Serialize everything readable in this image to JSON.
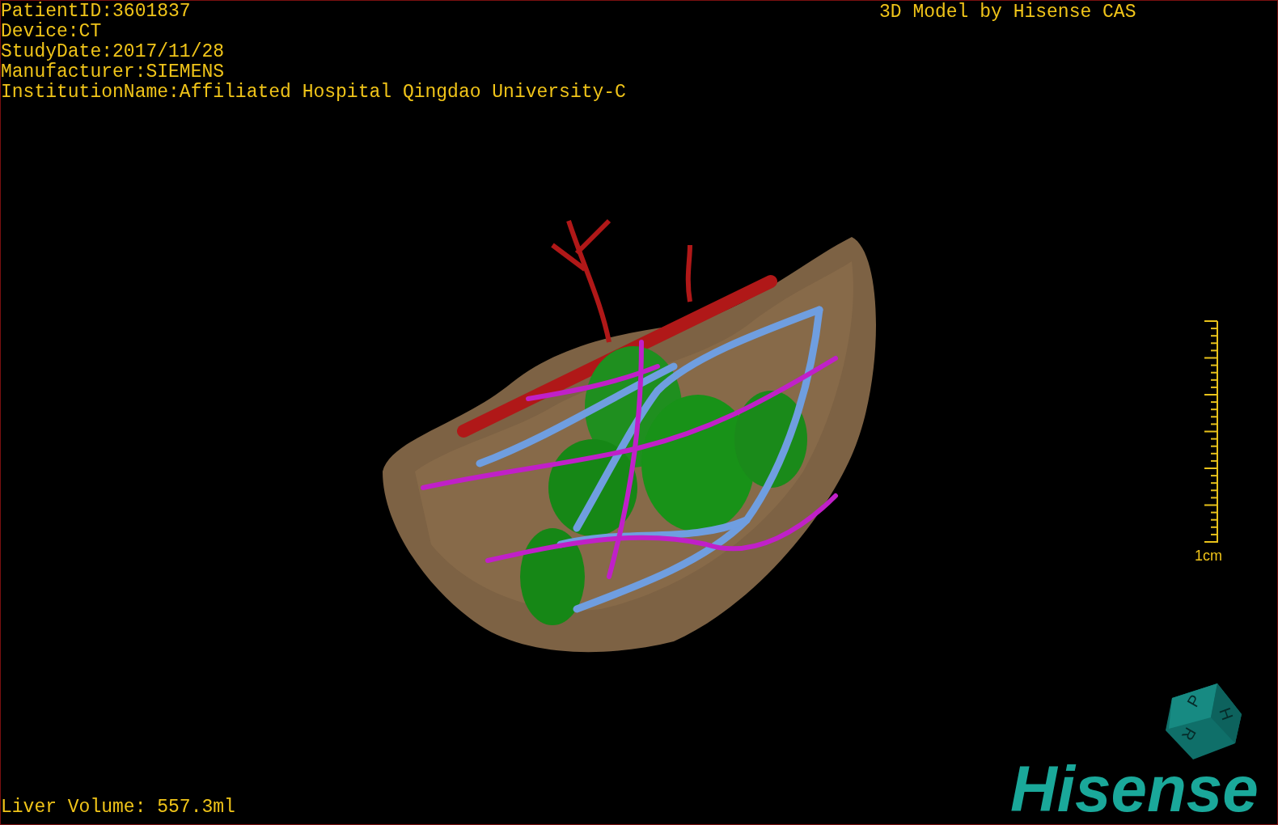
{
  "patient_info": [
    "PatientID:3601837",
    "Device:CT",
    "StudyDate:2017/11/28",
    "Manufacturer:SIEMENS",
    "InstitutionName:Affiliated Hospital Qingdao University-C"
  ],
  "title": "3D Model by Hisense CAS",
  "scale_bar": {
    "label": "1cm"
  },
  "orientation_cube": {
    "faces": [
      "P",
      "H",
      "R"
    ]
  },
  "logo": {
    "text": "Hisense"
  },
  "liver_volume": "Liver Volume: 557.3ml"
}
